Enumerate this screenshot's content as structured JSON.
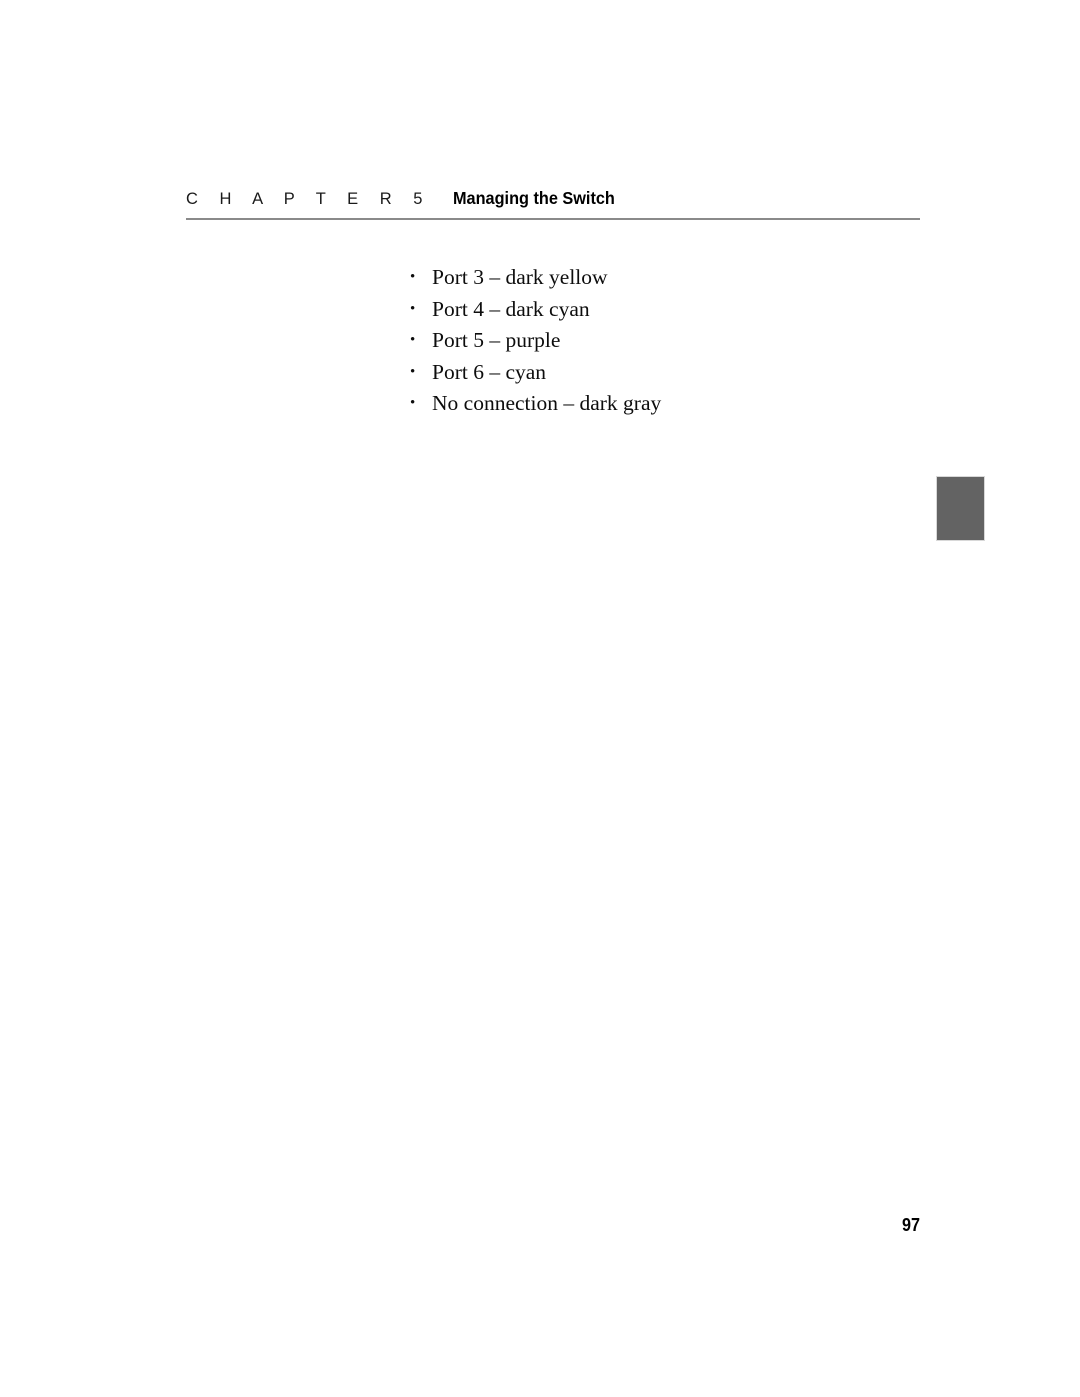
{
  "page": {
    "background_color": "#ffffff",
    "text_color": "#0d0d0d",
    "folio": "97"
  },
  "header": {
    "eyebrow": "C H A P T E R 5",
    "title": "Managing the Switch",
    "rule_color": "#8a8a8a"
  },
  "body": {
    "bullet_glyph": "•",
    "items": [
      {
        "text": "Port 3 – dark yellow"
      },
      {
        "text": "Port 4 – dark cyan"
      },
      {
        "text": "Port 5 – purple"
      },
      {
        "text": "Port 6 – cyan"
      },
      {
        "text": "No connection – dark gray"
      }
    ]
  },
  "thumb_tab": {
    "color": "#636363",
    "border_color": "#d8d8d8"
  }
}
